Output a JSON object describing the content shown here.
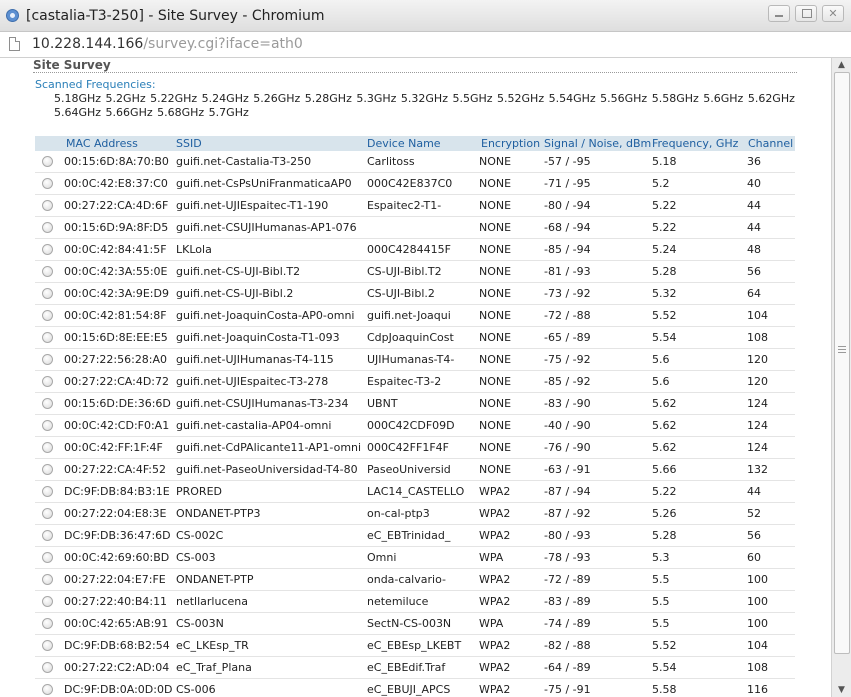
{
  "window": {
    "title": "[castalia-T3-250] - Site Survey - Chromium"
  },
  "url": {
    "host": "10.228.144.166",
    "path": "/survey.cgi?iface=ath0"
  },
  "page": {
    "heading": "Site Survey",
    "scanned_label": "Scanned Frequencies:",
    "frequencies": "5.18GHz 5.2GHz 5.22GHz 5.24GHz 5.26GHz 5.28GHz 5.3GHz 5.32GHz 5.5GHz 5.52GHz 5.54GHz 5.56GHz 5.58GHz 5.6GHz 5.62GHz 5.64GHz 5.66GHz 5.68GHz 5.7GHz"
  },
  "table": {
    "headers": {
      "mac": "MAC Address",
      "ssid": "SSID",
      "device": "Device Name",
      "enc": "Encryption",
      "signal": "Signal / Noise, dBm",
      "freq": "Frequency, GHz",
      "channel": "Channel"
    },
    "rows": [
      {
        "mac": "00:15:6D:8A:70:B0",
        "ssid": "guifi.net-Castalia-T3-250",
        "device": "Carlitoss",
        "enc": "NONE",
        "signal": "-57 / -95",
        "freq": "5.18",
        "channel": "36"
      },
      {
        "mac": "00:0C:42:E8:37:C0",
        "ssid": "guifi.net-CsPsUniFranmaticaAP0",
        "device": "000C42E837C0",
        "enc": "NONE",
        "signal": "-71 / -95",
        "freq": "5.2",
        "channel": "40"
      },
      {
        "mac": "00:27:22:CA:4D:6F",
        "ssid": "guifi.net-UJIEspaitec-T1-190",
        "device": "Espaitec2-T1-",
        "enc": "NONE",
        "signal": "-80 / -94",
        "freq": "5.22",
        "channel": "44"
      },
      {
        "mac": "00:15:6D:9A:8F:D5",
        "ssid": "guifi.net-CSUJIHumanas-AP1-076",
        "device": "",
        "enc": "NONE",
        "signal": "-68 / -94",
        "freq": "5.22",
        "channel": "44"
      },
      {
        "mac": "00:0C:42:84:41:5F",
        "ssid": "LKLola",
        "device": "000C4284415F",
        "enc": "NONE",
        "signal": "-85 / -94",
        "freq": "5.24",
        "channel": "48"
      },
      {
        "mac": "00:0C:42:3A:55:0E",
        "ssid": "guifi.net-CS-UJI-Bibl.T2",
        "device": "CS-UJI-Bibl.T2",
        "enc": "NONE",
        "signal": "-81 / -93",
        "freq": "5.28",
        "channel": "56"
      },
      {
        "mac": "00:0C:42:3A:9E:D9",
        "ssid": "guifi.net-CS-UJI-Bibl.2",
        "device": "CS-UJI-Bibl.2",
        "enc": "NONE",
        "signal": "-73 / -92",
        "freq": "5.32",
        "channel": "64"
      },
      {
        "mac": "00:0C:42:81:54:8F",
        "ssid": "guifi.net-JoaquinCosta-AP0-omni",
        "device": "guifi.net-Joaqui",
        "enc": "NONE",
        "signal": "-72 / -88",
        "freq": "5.52",
        "channel": "104"
      },
      {
        "mac": "00:15:6D:8E:EE:E5",
        "ssid": "guifi.net-JoaquinCosta-T1-093",
        "device": "CdpJoaquinCost",
        "enc": "NONE",
        "signal": "-65 / -89",
        "freq": "5.54",
        "channel": "108"
      },
      {
        "mac": "00:27:22:56:28:A0",
        "ssid": "guifi.net-UJIHumanas-T4-115",
        "device": "UJIHumanas-T4-",
        "enc": "NONE",
        "signal": "-75 / -92",
        "freq": "5.6",
        "channel": "120"
      },
      {
        "mac": "00:27:22:CA:4D:72",
        "ssid": "guifi.net-UJIEspaitec-T3-278",
        "device": "Espaitec-T3-2",
        "enc": "NONE",
        "signal": "-85 / -92",
        "freq": "5.6",
        "channel": "120"
      },
      {
        "mac": "00:15:6D:DE:36:6D",
        "ssid": "guifi.net-CSUJIHumanas-T3-234",
        "device": "UBNT",
        "enc": "NONE",
        "signal": "-83 / -90",
        "freq": "5.62",
        "channel": "124"
      },
      {
        "mac": "00:0C:42:CD:F0:A1",
        "ssid": "guifi.net-castalia-AP04-omni",
        "device": "000C42CDF09D",
        "enc": "NONE",
        "signal": "-40 / -90",
        "freq": "5.62",
        "channel": "124"
      },
      {
        "mac": "00:0C:42:FF:1F:4F",
        "ssid": "guifi.net-CdPAlicante11-AP1-omni",
        "device": "000C42FF1F4F",
        "enc": "NONE",
        "signal": "-76 / -90",
        "freq": "5.62",
        "channel": "124"
      },
      {
        "mac": "00:27:22:CA:4F:52",
        "ssid": "guifi.net-PaseoUniversidad-T4-80",
        "device": "PaseoUniversid",
        "enc": "NONE",
        "signal": "-63 / -91",
        "freq": "5.66",
        "channel": "132"
      },
      {
        "mac": "DC:9F:DB:84:B3:1E",
        "ssid": "PRORED",
        "device": "LAC14_CASTELLO",
        "enc": "WPA2",
        "signal": "-87 / -94",
        "freq": "5.22",
        "channel": "44"
      },
      {
        "mac": "00:27:22:04:E8:3E",
        "ssid": "ONDANET-PTP3",
        "device": "on-cal-ptp3",
        "enc": "WPA2",
        "signal": "-87 / -92",
        "freq": "5.26",
        "channel": "52"
      },
      {
        "mac": "DC:9F:DB:36:47:6D",
        "ssid": "CS-002C",
        "device": "eC_EBTrinidad_",
        "enc": "WPA2",
        "signal": "-80 / -93",
        "freq": "5.28",
        "channel": "56"
      },
      {
        "mac": "00:0C:42:69:60:BD",
        "ssid": "CS-003",
        "device": "Omni",
        "enc": "WPA",
        "signal": "-78 / -93",
        "freq": "5.3",
        "channel": "60"
      },
      {
        "mac": "00:27:22:04:E7:FE",
        "ssid": "ONDANET-PTP",
        "device": "onda-calvario-",
        "enc": "WPA2",
        "signal": "-72 / -89",
        "freq": "5.5",
        "channel": "100"
      },
      {
        "mac": "00:27:22:40:B4:11",
        "ssid": "netllarlucena",
        "device": "netemiluce",
        "enc": "WPA2",
        "signal": "-83 / -89",
        "freq": "5.5",
        "channel": "100"
      },
      {
        "mac": "00:0C:42:65:AB:91",
        "ssid": "CS-003N",
        "device": "SectN-CS-003N",
        "enc": "WPA",
        "signal": "-74 / -89",
        "freq": "5.5",
        "channel": "100"
      },
      {
        "mac": "DC:9F:DB:68:B2:54",
        "ssid": "eC_LKEsp_TR",
        "device": "eC_EBEsp_LKEBT",
        "enc": "WPA2",
        "signal": "-82 / -88",
        "freq": "5.52",
        "channel": "104"
      },
      {
        "mac": "00:27:22:C2:AD:04",
        "ssid": "eC_Traf_Plana",
        "device": "eC_EBEdif.Traf",
        "enc": "WPA2",
        "signal": "-64 / -89",
        "freq": "5.54",
        "channel": "108"
      },
      {
        "mac": "DC:9F:DB:0A:0D:0D",
        "ssid": "CS-006",
        "device": "eC_EBUJI_APCS",
        "enc": "WPA2",
        "signal": "-75 / -91",
        "freq": "5.58",
        "channel": "116"
      }
    ]
  },
  "icons": {
    "app": "chromium-icon",
    "page": "page-icon",
    "scroll_up": "▲",
    "scroll_down": "▼"
  }
}
